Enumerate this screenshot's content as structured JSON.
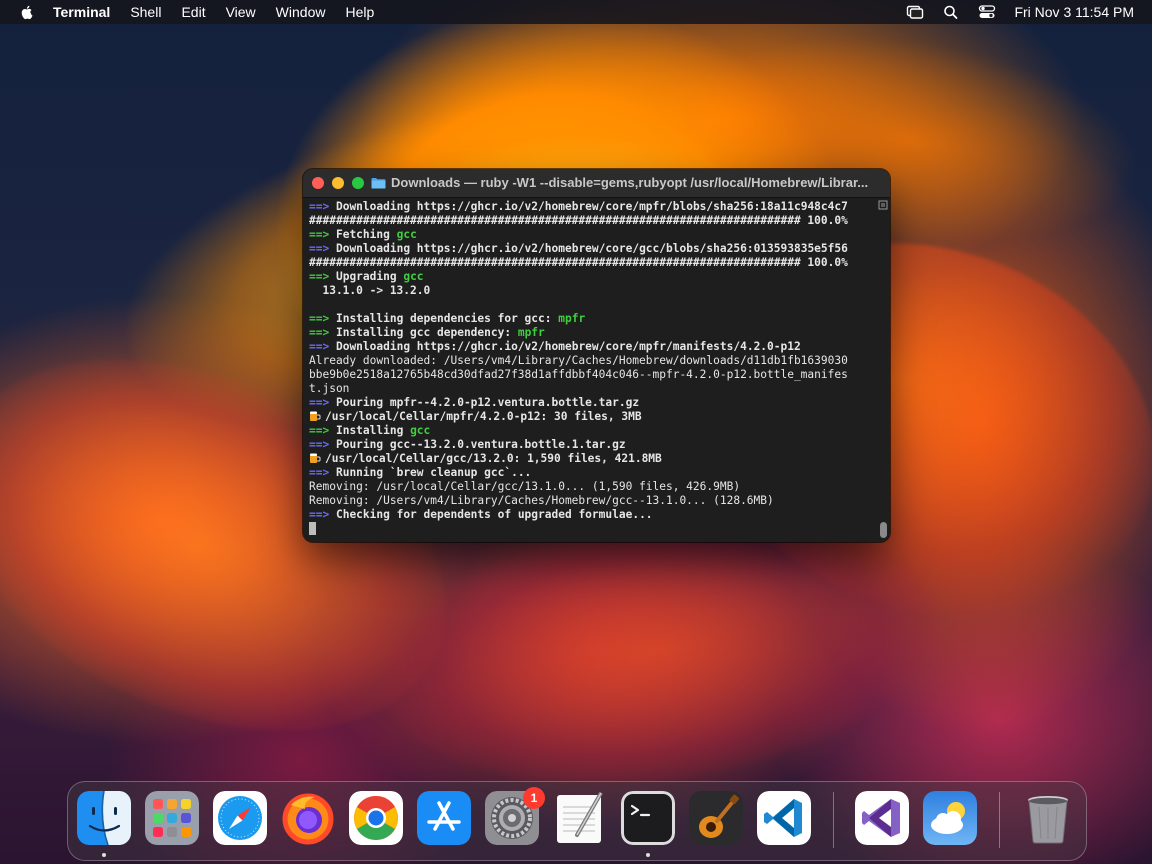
{
  "menubar": {
    "app_name": "Terminal",
    "items": [
      "Shell",
      "Edit",
      "View",
      "Window",
      "Help"
    ],
    "clock": "Fri Nov 3  11:54 PM",
    "icons": [
      "screen-mirroring-icon",
      "search-icon",
      "control-center-icon"
    ]
  },
  "window": {
    "title": "Downloads — ruby -W1 --disable=gems,rubyopt /usr/local/Homebrew/Librar...",
    "lines": [
      {
        "kind": "arrow",
        "text": "Downloading https://ghcr.io/v2/homebrew/core/mpfr/blobs/sha256:18a11c948c4c7"
      },
      {
        "kind": "plain",
        "text": "######################################################################### 100.0%"
      },
      {
        "kind": "arrow-green",
        "text": "Fetching ",
        "hl": "gcc"
      },
      {
        "kind": "arrow",
        "text": "Downloading https://ghcr.io/v2/homebrew/core/gcc/blobs/sha256:013593835e5f56"
      },
      {
        "kind": "plain",
        "text": "######################################################################### 100.0%"
      },
      {
        "kind": "arrow-green",
        "text": "Upgrading ",
        "hl": "gcc"
      },
      {
        "kind": "plain",
        "text": "  13.1.0 -> 13.2.0"
      },
      {
        "kind": "blank",
        "text": ""
      },
      {
        "kind": "arrow-green",
        "text": "Installing dependencies for gcc: ",
        "hl": "mpfr"
      },
      {
        "kind": "arrow-green",
        "text": "Installing gcc dependency: ",
        "hl": "mpfr"
      },
      {
        "kind": "arrow",
        "text": "Downloading https://ghcr.io/v2/homebrew/core/mpfr/manifests/4.2.0-p12"
      },
      {
        "kind": "thin",
        "text": "Already downloaded: /Users/vm4/Library/Caches/Homebrew/downloads/d11db1fb1639030"
      },
      {
        "kind": "thin",
        "text": "bbe9b0e2518a12765b48cd30dfad27f38d1affdbbf404c046--mpfr-4.2.0-p12.bottle_manifes"
      },
      {
        "kind": "thin",
        "text": "t.json"
      },
      {
        "kind": "arrow",
        "text": "Pouring mpfr--4.2.0-p12.ventura.bottle.tar.gz"
      },
      {
        "kind": "beer",
        "text": "/usr/local/Cellar/mpfr/4.2.0-p12: 30 files, 3MB"
      },
      {
        "kind": "arrow-green",
        "text": "Installing ",
        "hl": "gcc"
      },
      {
        "kind": "arrow",
        "text": "Pouring gcc--13.2.0.ventura.bottle.1.tar.gz"
      },
      {
        "kind": "beer",
        "text": "/usr/local/Cellar/gcc/13.2.0: 1,590 files, 421.8MB"
      },
      {
        "kind": "arrow",
        "text": "Running `brew cleanup gcc`..."
      },
      {
        "kind": "thin",
        "text": "Removing: /usr/local/Cellar/gcc/13.1.0... (1,590 files, 426.9MB)"
      },
      {
        "kind": "thin",
        "text": "Removing: /Users/vm4/Library/Caches/Homebrew/gcc--13.1.0... (128.6MB)"
      },
      {
        "kind": "arrow",
        "text": "Checking for dependents of upgraded formulae..."
      },
      {
        "kind": "cursor",
        "text": ""
      }
    ],
    "arrow_glyph": "==>"
  },
  "dock": {
    "apps": [
      {
        "name": "Finder",
        "icon": "finder-icon",
        "running": true
      },
      {
        "name": "Launchpad",
        "icon": "launchpad-icon",
        "running": false
      },
      {
        "name": "Safari",
        "icon": "safari-icon",
        "running": false
      },
      {
        "name": "Firefox",
        "icon": "firefox-icon",
        "running": false
      },
      {
        "name": "Google Chrome",
        "icon": "chrome-icon",
        "running": false
      },
      {
        "name": "App Store",
        "icon": "app-store-icon",
        "running": false
      },
      {
        "name": "System Settings",
        "icon": "system-settings-icon",
        "running": false,
        "badge": "1"
      },
      {
        "name": "TextEdit",
        "icon": "textedit-icon",
        "running": false
      },
      {
        "name": "Terminal",
        "icon": "terminal-icon",
        "running": true
      },
      {
        "name": "GarageBand",
        "icon": "garageband-icon",
        "running": false
      },
      {
        "name": "Visual Studio Code",
        "icon": "vscode-icon",
        "running": false
      },
      {
        "name": "Visual Studio",
        "icon": "visual-studio-icon",
        "running": false
      },
      {
        "name": "Weather",
        "icon": "weather-icon",
        "running": false
      },
      {
        "name": "Trash",
        "icon": "trash-icon",
        "running": false
      }
    ]
  },
  "colors": {
    "arrow_blue": "#6b6bff",
    "highlight_green": "#3fcf3f",
    "terminal_bg": "#1e1e1e",
    "badge_red": "#ff3b30"
  }
}
